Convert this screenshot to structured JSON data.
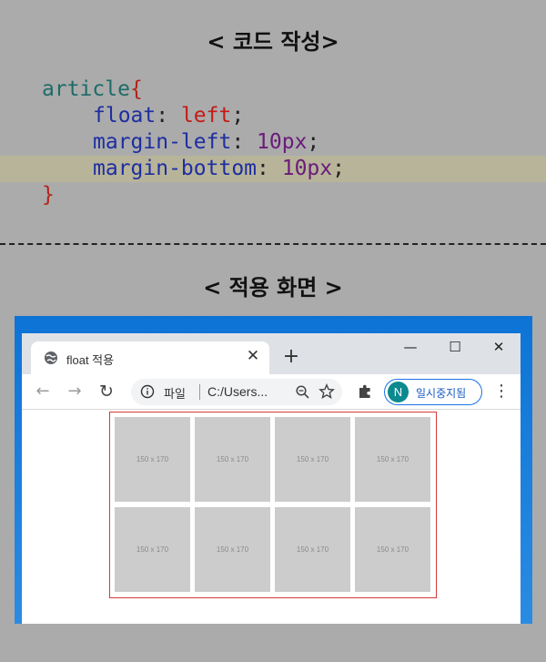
{
  "heading_code": "< 코드 작성>",
  "heading_result": "< 적용 화면 >",
  "code": {
    "selector": "article",
    "open_brace": "{",
    "close_brace": "}",
    "declarations": [
      {
        "property": "float",
        "value": "left"
      },
      {
        "property": "margin-left",
        "value": "10px"
      },
      {
        "property": "margin-bottom",
        "value": "10px"
      }
    ]
  },
  "browser": {
    "tab_title": "float 적용",
    "tab_close": "✕",
    "new_tab": "+",
    "window_controls": {
      "minimize": "—",
      "maximize": "☐",
      "close": "✕"
    },
    "nav": {
      "back": "←",
      "forward": "→",
      "reload": "↻"
    },
    "address_scheme": "파일",
    "address_url": "C:/Users...",
    "profile_initial": "N",
    "profile_status": "일시중지됨",
    "menu": "⋮",
    "icons": [
      "globe-icon",
      "info-icon",
      "zoom-icon",
      "star-icon",
      "extension-icon",
      "menu-icon"
    ],
    "accent": "#1a73e8"
  },
  "articles": [
    {
      "label": "150 x 170"
    },
    {
      "label": "150 x 170"
    },
    {
      "label": "150 x 170"
    },
    {
      "label": "150 x 170"
    },
    {
      "label": "150 x 170"
    },
    {
      "label": "150 x 170"
    },
    {
      "label": "150 x 170"
    },
    {
      "label": "150 x 170"
    }
  ],
  "colors": {
    "background": "#ababab",
    "highlight_line": "#b7b49a",
    "container_border": "#d43a3a",
    "article_fill": "#cccccc"
  }
}
